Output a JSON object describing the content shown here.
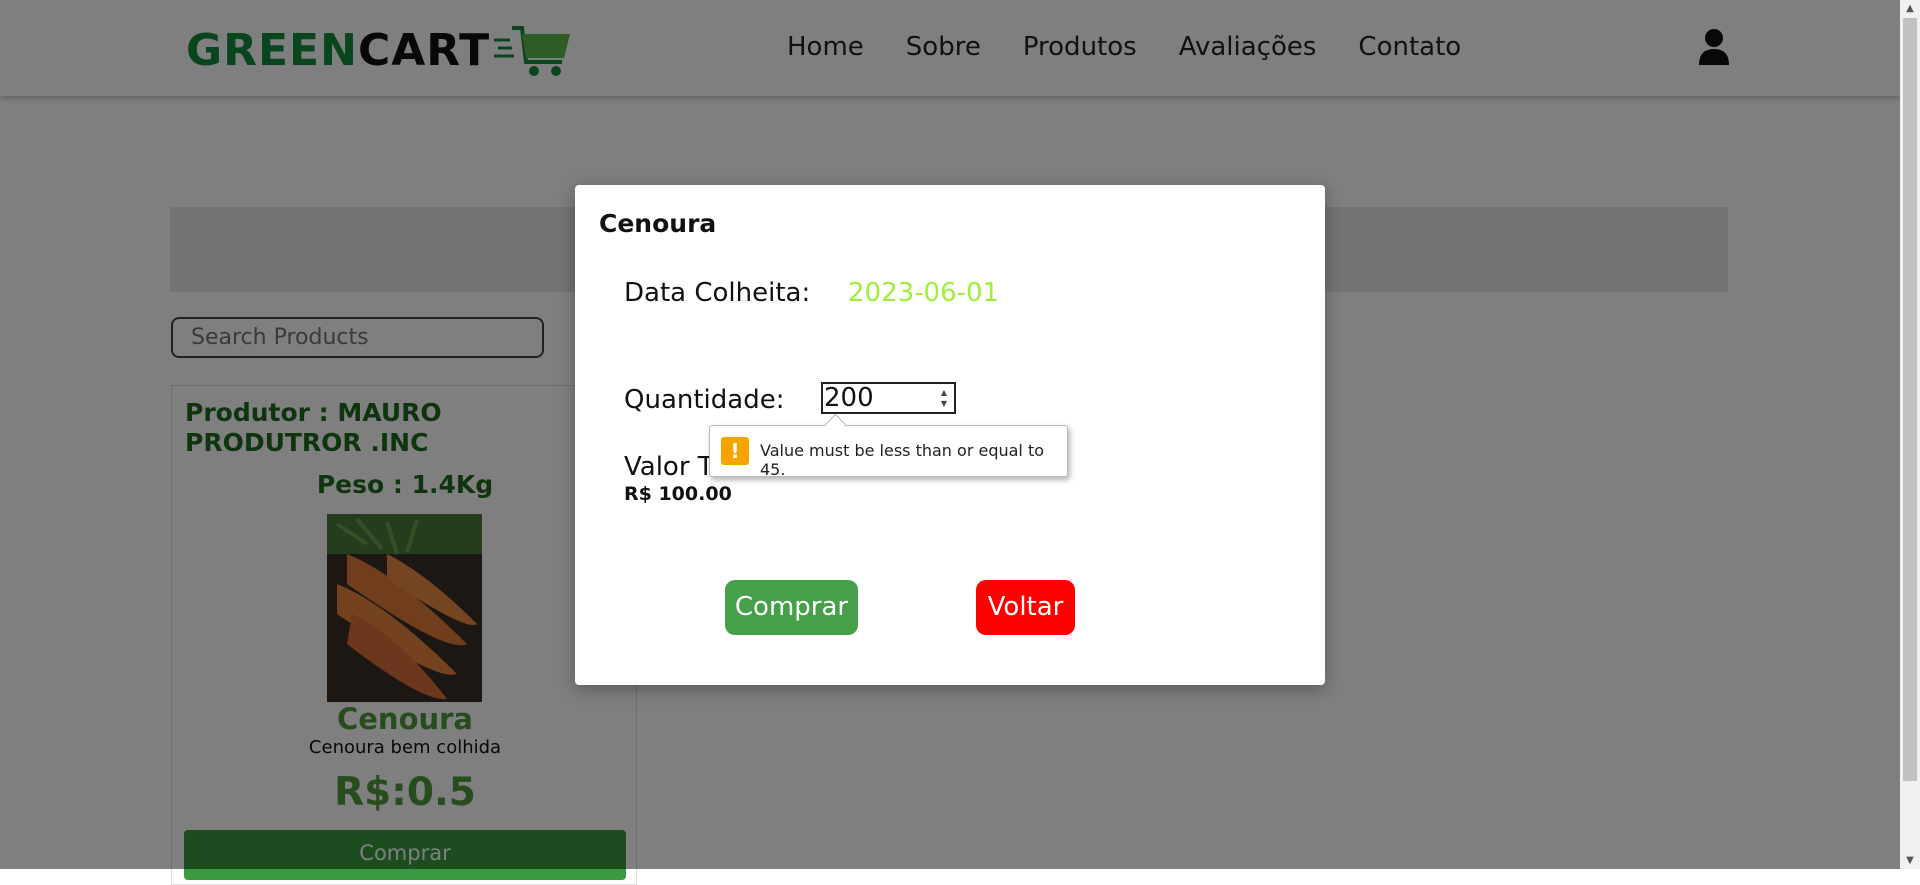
{
  "header": {
    "logo_green": "GREEN",
    "logo_black": "CART",
    "nav": [
      "Home",
      "Sobre",
      "Produtos",
      "Avaliações",
      "Contato"
    ],
    "user_icon": "user-icon"
  },
  "search": {
    "placeholder": "Search Products"
  },
  "product_card": {
    "producer": "Produtor : MAURO PRODUTROR .INC",
    "weight": "Peso : 1.4Kg",
    "name": "Cenoura",
    "description": "Cenoura bem colhida",
    "price": "R$:0.5",
    "buy_label": "Comprar"
  },
  "modal": {
    "title": "Cenoura",
    "harvest_label": "Data Colheita:",
    "harvest_value": "2023-06-01",
    "quantity_label": "Quantidade:",
    "quantity_value": "200",
    "total_label": "Valor T",
    "total_value": "R$ 100.00",
    "buy_label": "Comprar",
    "back_label": "Voltar"
  },
  "validation_tooltip": {
    "message": "Value must be less than or equal to 45."
  },
  "colors": {
    "brand_green": "#138a3a",
    "buy_green": "#45a049",
    "back_red": "#ff0000",
    "date_green": "#9ef03a",
    "warning": "#f7a400"
  }
}
